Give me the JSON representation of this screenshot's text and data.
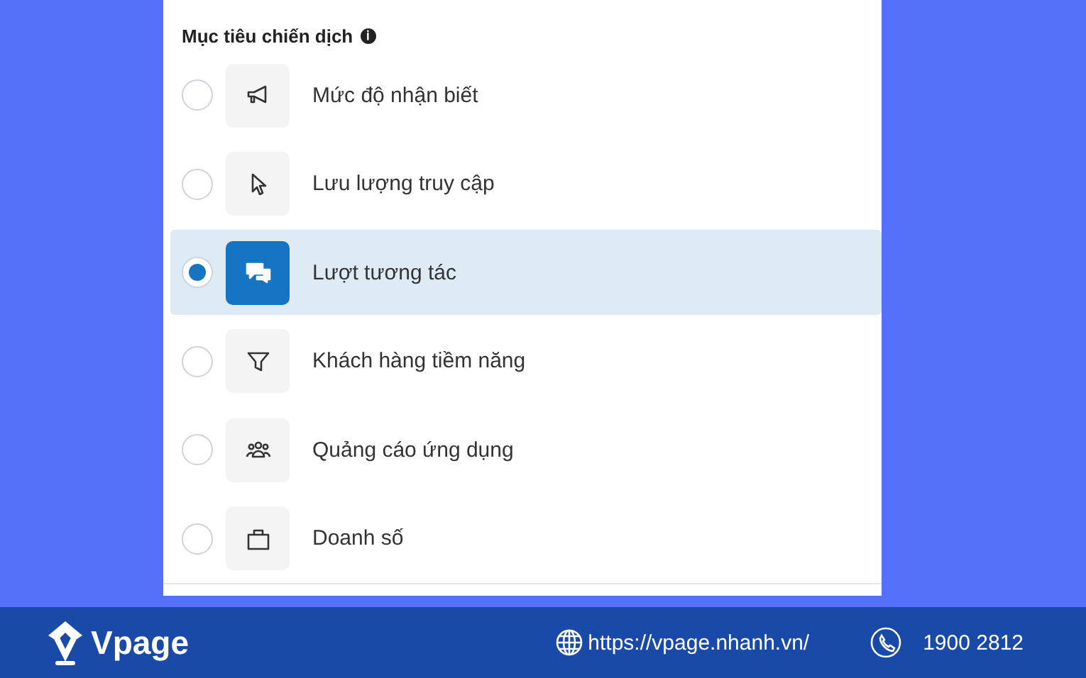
{
  "section": {
    "title": "Mục tiêu chiến dịch",
    "info_icon": "ℹ"
  },
  "objectives": [
    {
      "label": "Mức độ nhận biết",
      "kind": "megaphone",
      "selected": false
    },
    {
      "label": "Lưu lượng truy cập",
      "kind": "cursor",
      "selected": false
    },
    {
      "label": "Lượt tương tác",
      "kind": "chat",
      "selected": true
    },
    {
      "label": "Khách hàng tiềm năng",
      "kind": "funnel",
      "selected": false
    },
    {
      "label": "Quảng cáo ứng dụng",
      "kind": "people",
      "selected": false
    },
    {
      "label": "Doanh số",
      "kind": "bag",
      "selected": false
    }
  ],
  "footer": {
    "brand": "Vpage",
    "url": "https://vpage.nhanh.vn/",
    "phone": "1900 2812"
  }
}
